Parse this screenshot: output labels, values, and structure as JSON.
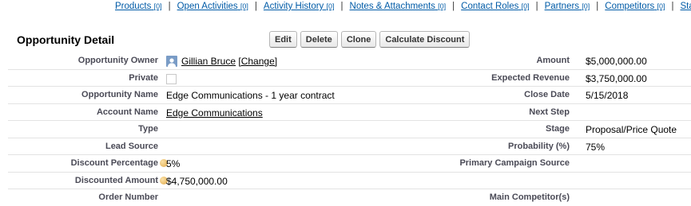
{
  "related_links": [
    {
      "label": "Products",
      "count": "[0]"
    },
    {
      "label": "Open Activities",
      "count": "[0]"
    },
    {
      "label": "Activity History",
      "count": "[0]"
    },
    {
      "label": "Notes & Attachments",
      "count": "[0]"
    },
    {
      "label": "Contact Roles",
      "count": "[0]"
    },
    {
      "label": "Partners",
      "count": "[0]"
    },
    {
      "label": "Competitors",
      "count": "[0]"
    },
    {
      "label": "Stag",
      "count": ""
    }
  ],
  "header": {
    "title": "Opportunity Detail",
    "buttons": {
      "edit": "Edit",
      "delete": "Delete",
      "clone": "Clone",
      "calculate_discount": "Calculate Discount"
    }
  },
  "left_fields": {
    "owner": {
      "label": "Opportunity Owner",
      "value": "Gillian Bruce",
      "action": "[Change]"
    },
    "private": {
      "label": "Private"
    },
    "name": {
      "label": "Opportunity Name",
      "value": "Edge Communications - 1 year contract"
    },
    "account": {
      "label": "Account Name",
      "value": "Edge Communications"
    },
    "type": {
      "label": "Type",
      "value": ""
    },
    "lead_source": {
      "label": "Lead Source",
      "value": ""
    },
    "discount_pct": {
      "label": "Discount Percentage",
      "value": "5%"
    },
    "discounted_amount": {
      "label": "Discounted Amount",
      "value": "$4,750,000.00"
    },
    "order_number": {
      "label": "Order Number"
    }
  },
  "right_fields": {
    "amount": {
      "label": "Amount",
      "value": "$5,000,000.00"
    },
    "expected_revenue": {
      "label": "Expected Revenue",
      "value": "$3,750,000.00"
    },
    "close_date": {
      "label": "Close Date",
      "value": "5/15/2018"
    },
    "next_step": {
      "label": "Next Step",
      "value": ""
    },
    "stage": {
      "label": "Stage",
      "value": "Proposal/Price Quote"
    },
    "probability": {
      "label": "Probability (%)",
      "value": "75%"
    },
    "primary_campaign": {
      "label": "Primary Campaign Source",
      "value": ""
    },
    "main_competitors": {
      "label": "Main Competitor(s)"
    }
  }
}
